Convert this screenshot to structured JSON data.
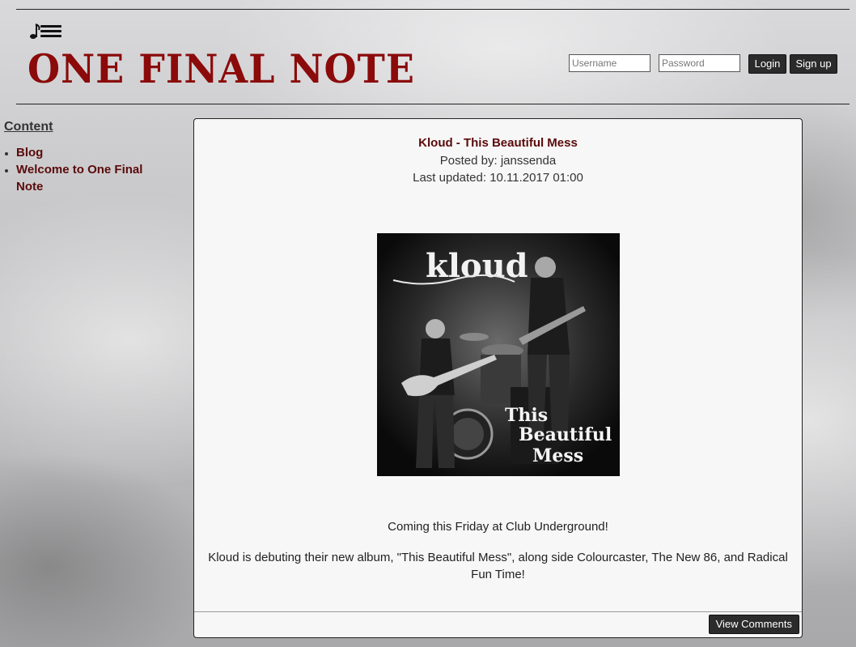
{
  "header": {
    "logo_icon": "music-note-list-icon",
    "title": "ONE FINAL NOTE",
    "title_color": "#8b0a0a"
  },
  "login": {
    "username_placeholder": "Username",
    "password_placeholder": "Password",
    "username_value": "",
    "password_value": "",
    "login_label": "Login",
    "signup_label": "Sign up"
  },
  "sidebar": {
    "heading": "Content",
    "items": [
      {
        "label": "Blog"
      },
      {
        "label": "Welcome to One Final Note"
      }
    ]
  },
  "post": {
    "title": "Kloud - This Beautiful Mess",
    "posted_by": "Posted by: janssenda",
    "last_updated": "Last updated: 10.11.2017 01:00",
    "image": {
      "band_logo_text": "kloud",
      "album_text_1": "This",
      "album_text_2": "Beautiful",
      "album_text_3": "Mess"
    },
    "paragraphs": [
      "Coming this Friday at Club Underground!",
      "Kloud is debuting their new album, \"This Beautiful Mess\", along side Colourcaster, The New 86, and Radical Fun Time!"
    ],
    "view_comments_label": "View Comments"
  },
  "colors": {
    "accent_dark_red": "#5b0a0a",
    "button_dark": "#2b2b2b",
    "panel_background": "#f7f7f7"
  }
}
